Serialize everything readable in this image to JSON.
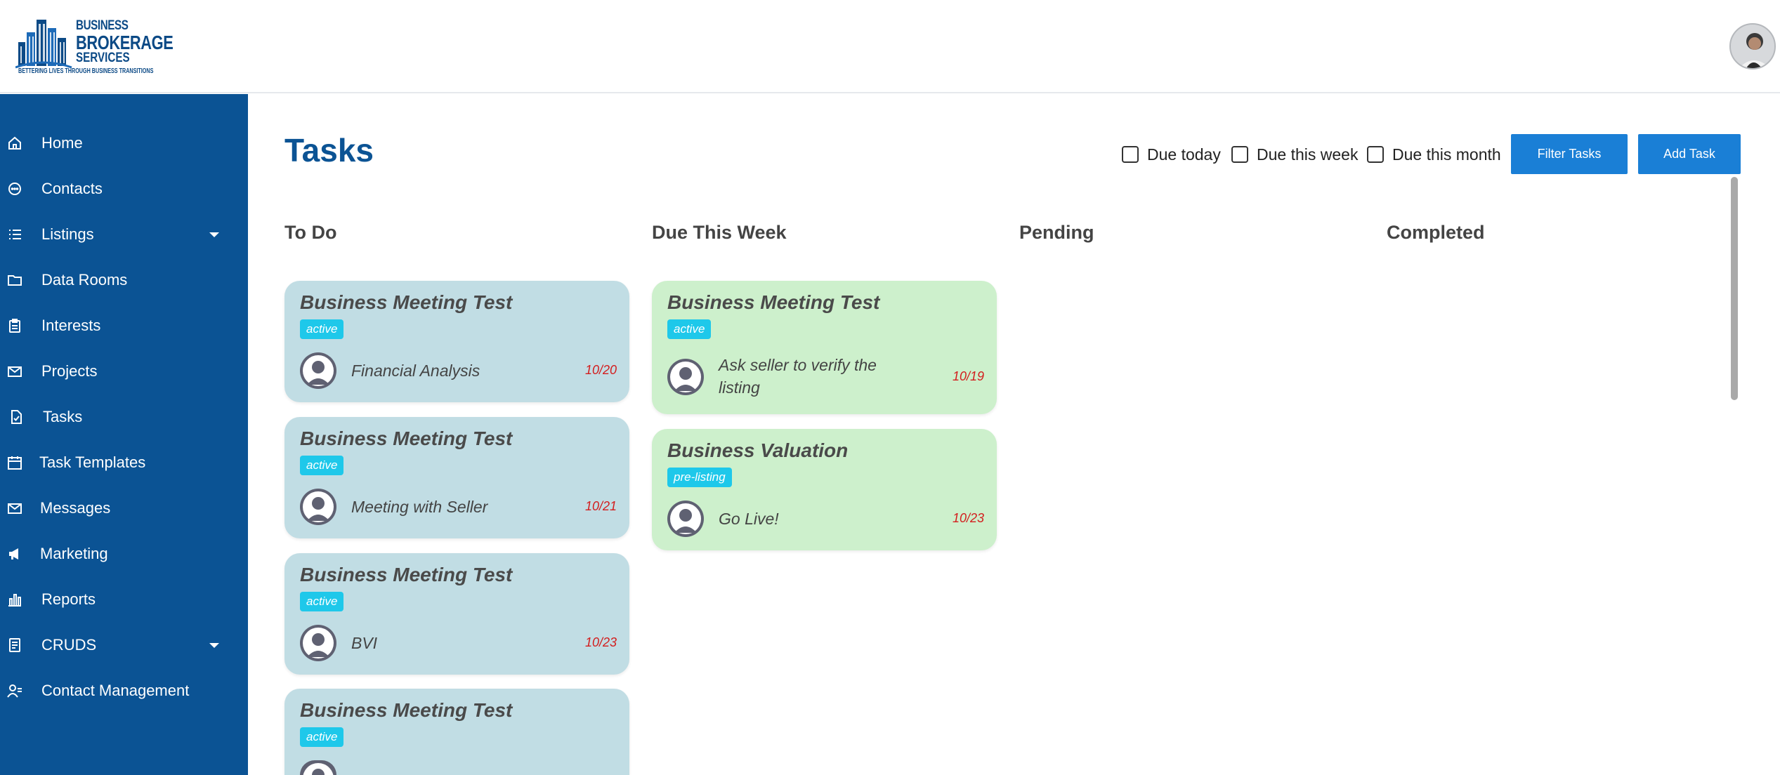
{
  "brand": {
    "line1": "BUSINESS",
    "line2": "BROKERAGE",
    "line3": "SERVICES",
    "tagline": "BETTERING LIVES THROUGH BUSINESS TRANSITIONS",
    "primary_color": "#0b5394"
  },
  "sidebar": {
    "items": [
      {
        "label": "Home",
        "icon": "home-icon"
      },
      {
        "label": "Contacts",
        "icon": "chat-bubble-icon"
      },
      {
        "label": "Listings",
        "icon": "list-icon",
        "has_submenu": true
      },
      {
        "label": "Data Rooms",
        "icon": "folder-icon"
      },
      {
        "label": "Interests",
        "icon": "clipboard-icon"
      },
      {
        "label": "Projects",
        "icon": "envelope-icon"
      },
      {
        "label": "Tasks",
        "icon": "task-check-icon",
        "active": true
      },
      {
        "label": "Task Templates",
        "icon": "calendar-icon"
      },
      {
        "label": "Messages",
        "icon": "envelope-icon"
      },
      {
        "label": "Marketing",
        "icon": "megaphone-icon"
      },
      {
        "label": "Reports",
        "icon": "bar-chart-icon"
      },
      {
        "label": "CRUDS",
        "icon": "document-icon",
        "has_submenu": true
      },
      {
        "label": "Contact Management",
        "icon": "user-list-icon"
      }
    ]
  },
  "page": {
    "title": "Tasks",
    "filters": [
      "Due today",
      "Due this week",
      "Due this month"
    ],
    "filter_button": "Filter Tasks",
    "add_button": "Add Task"
  },
  "columns": [
    {
      "title": "To Do",
      "cards": [
        {
          "title": "Business Meeting Test",
          "status": "active",
          "task": "Financial Analysis",
          "due": "10/20"
        },
        {
          "title": "Business Meeting Test",
          "status": "active",
          "task": "Meeting with Seller",
          "due": "10/21"
        },
        {
          "title": "Business Meeting Test",
          "status": "active",
          "task": "BVI",
          "due": "10/23"
        },
        {
          "title": "Business Meeting Test",
          "status": "active",
          "task": "",
          "due": ""
        }
      ]
    },
    {
      "title": "Due This Week",
      "cards": [
        {
          "title": "Business Meeting Test",
          "status": "active",
          "task_line1": "Ask seller to verify the",
          "task_line2": "listing",
          "due": "10/19"
        },
        {
          "title": "Business Valuation",
          "status": "pre-listing",
          "task": "Go Live!",
          "due": "10/23"
        }
      ]
    },
    {
      "title": "Pending",
      "cards": []
    },
    {
      "title": "Completed",
      "cards": []
    }
  ]
}
